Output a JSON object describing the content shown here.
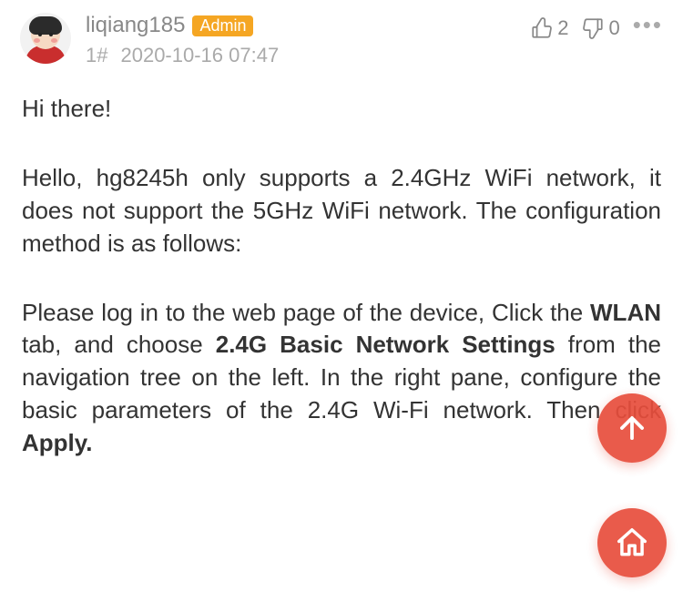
{
  "post": {
    "author": {
      "username": "liqiang185",
      "badge": "Admin"
    },
    "floor": "1#",
    "timestamp": "2020-10-16 07:47",
    "votes": {
      "up": "2",
      "down": "0"
    },
    "body": {
      "greeting": "Hi there!",
      "p1": "Hello, hg8245h only supports a 2.4GHz WiFi network, it does not support the 5GHz WiFi network. The configuration method is as follows:",
      "p2_a": "Please log in to the web page of the device, Click the ",
      "p2_b1": "WLAN",
      "p2_c": " tab, and choose ",
      "p2_b2": "2.4G Basic Network Settings",
      "p2_d": " from the navigation tree on the left. In the right pane, configure the basic parameters of the 2.4G Wi-Fi network.  Then click ",
      "p2_b3": "Apply."
    }
  }
}
